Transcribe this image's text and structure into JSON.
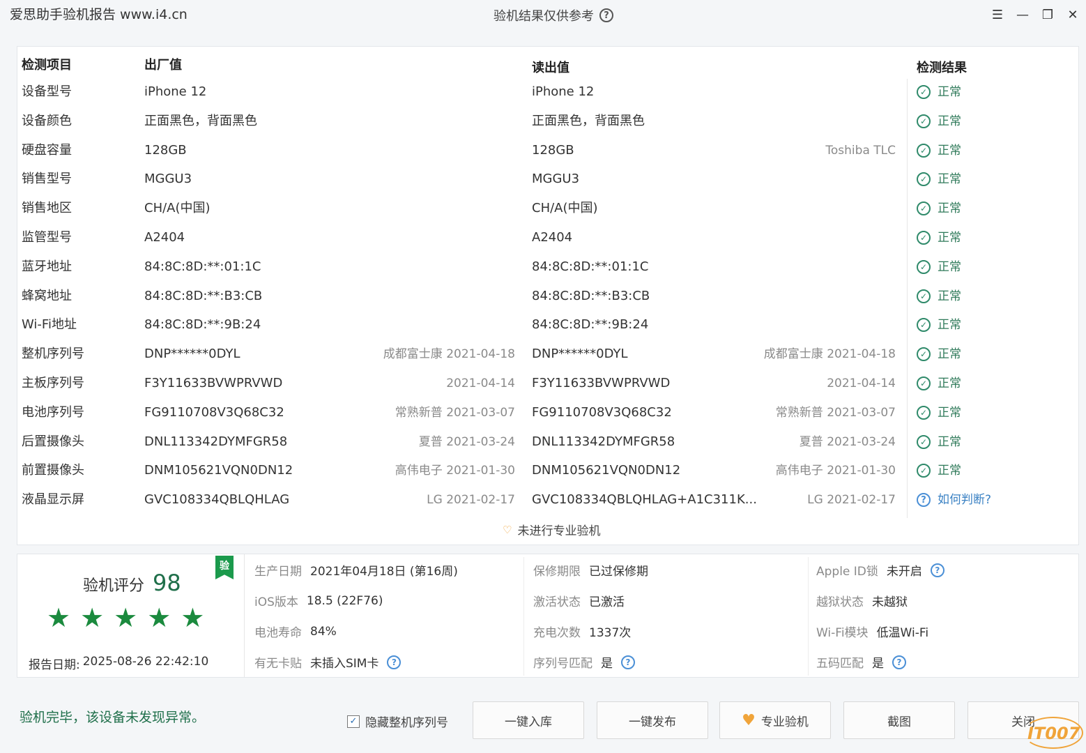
{
  "titlebar": {
    "app_title": "爱思助手验机报告 www.i4.cn",
    "center_title": "验机结果仅供参考",
    "controls": [
      "list-icon",
      "minimize-icon",
      "restore-icon",
      "close-icon"
    ]
  },
  "table": {
    "headers": {
      "item": "检测项目",
      "factory": "出厂值",
      "read": "读出值",
      "result": "检测结果"
    },
    "rows": [
      {
        "label": "设备型号",
        "factory": "iPhone 12",
        "factory_note": "",
        "read": "iPhone 12",
        "read_note": "",
        "result": "正常",
        "status": "ok"
      },
      {
        "label": "设备颜色",
        "factory": "正面黑色，背面黑色",
        "factory_note": "",
        "read": "正面黑色，背面黑色",
        "read_note": "",
        "result": "正常",
        "status": "ok"
      },
      {
        "label": "硬盘容量",
        "factory": "128GB",
        "factory_note": "",
        "read": "128GB",
        "read_note": "Toshiba TLC",
        "result": "正常",
        "status": "ok"
      },
      {
        "label": "销售型号",
        "factory": "MGGU3",
        "factory_note": "",
        "read": "MGGU3",
        "read_note": "",
        "result": "正常",
        "status": "ok"
      },
      {
        "label": "销售地区",
        "factory": "CH/A(中国)",
        "factory_note": "",
        "read": "CH/A(中国)",
        "read_note": "",
        "result": "正常",
        "status": "ok"
      },
      {
        "label": "监管型号",
        "factory": "A2404",
        "factory_note": "",
        "read": "A2404",
        "read_note": "",
        "result": "正常",
        "status": "ok"
      },
      {
        "label": "蓝牙地址",
        "factory": "84:8C:8D:**:01:1C",
        "factory_note": "",
        "read": "84:8C:8D:**:01:1C",
        "read_note": "",
        "result": "正常",
        "status": "ok"
      },
      {
        "label": "蜂窝地址",
        "factory": "84:8C:8D:**:B3:CB",
        "factory_note": "",
        "read": "84:8C:8D:**:B3:CB",
        "read_note": "",
        "result": "正常",
        "status": "ok"
      },
      {
        "label": "Wi-Fi地址",
        "factory": "84:8C:8D:**:9B:24",
        "factory_note": "",
        "read": "84:8C:8D:**:9B:24",
        "read_note": "",
        "result": "正常",
        "status": "ok"
      },
      {
        "label": "整机序列号",
        "factory": "DNP******0DYL",
        "factory_note": "成都富士康 2021-04-18",
        "read": "DNP******0DYL",
        "read_note": "成都富士康 2021-04-18",
        "result": "正常",
        "status": "ok"
      },
      {
        "label": "主板序列号",
        "factory": "F3Y11633BVWPRVWD",
        "factory_note": "2021-04-14",
        "read": "F3Y11633BVWPRVWD",
        "read_note": "2021-04-14",
        "result": "正常",
        "status": "ok"
      },
      {
        "label": "电池序列号",
        "factory": "FG9110708V3Q68C32",
        "factory_note": "常熟新普 2021-03-07",
        "read": "FG9110708V3Q68C32",
        "read_note": "常熟新普 2021-03-07",
        "result": "正常",
        "status": "ok"
      },
      {
        "label": "后置摄像头",
        "factory": "DNL113342DYMFGR58",
        "factory_note": "夏普 2021-03-24",
        "read": "DNL113342DYMFGR58",
        "read_note": "夏普 2021-03-24",
        "result": "正常",
        "status": "ok"
      },
      {
        "label": "前置摄像头",
        "factory": "DNM105621VQN0DN12",
        "factory_note": "高伟电子 2021-01-30",
        "read": "DNM105621VQN0DN12",
        "read_note": "高伟电子 2021-01-30",
        "result": "正常",
        "status": "ok"
      },
      {
        "label": "液晶显示屏",
        "factory": "GVC108334QBLQHLAG",
        "factory_note": "LG 2021-02-17",
        "read": "GVC108334QBLQHLAG+A1C311K...",
        "read_note": "LG 2021-02-17",
        "result": "如何判断?",
        "status": "question"
      }
    ],
    "pro_note": "未进行专业验机"
  },
  "summary": {
    "badge": "验",
    "score_label": "验机评分",
    "score": "98",
    "stars": 5,
    "report_date_label": "报告日期:",
    "report_date": "2025-08-26 22:42:10",
    "items": [
      {
        "key": "生产日期",
        "value": "2021年04月18日 (第16周)",
        "help": false
      },
      {
        "key": "iOS版本",
        "value": "18.5 (22F76)",
        "help": false
      },
      {
        "key": "电池寿命",
        "value": "84%",
        "help": false
      },
      {
        "key": "有无卡贴",
        "value": "未插入SIM卡",
        "help": true
      },
      {
        "key": "保修期限",
        "value": "已过保修期",
        "help": false
      },
      {
        "key": "激活状态",
        "value": "已激活",
        "help": false
      },
      {
        "key": "充电次数",
        "value": "1337次",
        "help": false
      },
      {
        "key": "序列号匹配",
        "value": "是",
        "help": true
      },
      {
        "key": "Apple ID锁",
        "value": "未开启",
        "help": true
      },
      {
        "key": "越狱状态",
        "value": "未越狱",
        "help": false
      },
      {
        "key": "Wi-Fi模块",
        "value": "低温Wi-Fi",
        "help": false
      },
      {
        "key": "五码匹配",
        "value": "是",
        "help": true
      }
    ]
  },
  "footer": {
    "status": "验机完毕，该设备未发现异常。",
    "hide_serial_label": "隐藏整机序列号",
    "hide_serial_checked": true,
    "buttons": [
      "一键入库",
      "一键发布",
      "专业验机",
      "截图",
      "关闭"
    ],
    "watermark": "IT007"
  },
  "colors": {
    "accent_green": "#1b8a3e",
    "ok_green": "#2f8a6a",
    "question_blue": "#3b82c4",
    "heart_orange": "#f0a43a"
  }
}
